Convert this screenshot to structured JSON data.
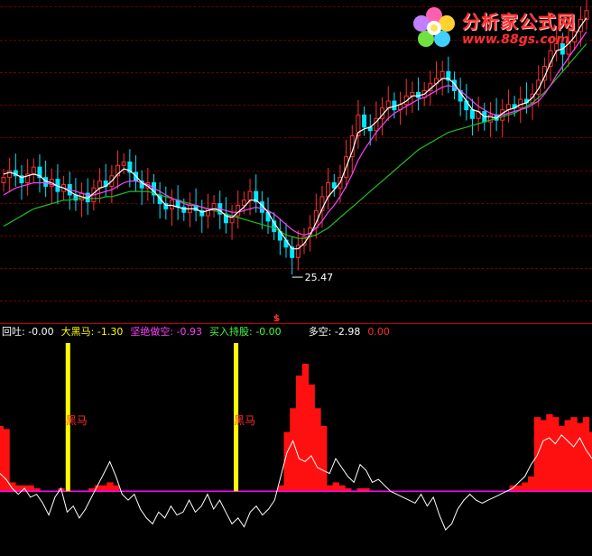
{
  "chart_data": [
    {
      "type": "candlestick",
      "ylim": [
        23.5,
        41
      ],
      "low_annotation": {
        "label": "25.47",
        "value": 25.47
      },
      "signal_marker": "$",
      "colors": {
        "up": "#ff3030",
        "down": "#00e5ff",
        "ma_white": "#ffffff",
        "ma_magenta": "#ff40ff",
        "ma_green": "#20c020"
      },
      "close": [
        31.2,
        31.6,
        31.3,
        30.9,
        31.4,
        31.8,
        31.2,
        30.7,
        31.1,
        30.4,
        30.8,
        30.2,
        29.9,
        30.3,
        29.8,
        30.6,
        31.0,
        30.7,
        31.3,
        31.9,
        32.1,
        31.5,
        31.0,
        30.6,
        30.9,
        30.2,
        29.7,
        29.4,
        29.9,
        29.5,
        29.2,
        29.6,
        29.3,
        29.0,
        29.4,
        29.7,
        29.1,
        28.6,
        29.0,
        29.6,
        29.9,
        30.4,
        29.8,
        29.2,
        28.7,
        28.1,
        27.6,
        27.2,
        26.6,
        27.3,
        27.8,
        28.3,
        29.3,
        30.1,
        30.9,
        30.6,
        31.2,
        32.4,
        33.6,
        34.8,
        34.1,
        33.9,
        34.6,
        35.2,
        35.6,
        35.1,
        35.4,
        35.9,
        36.1,
        35.8,
        36.2,
        36.6,
        36.9,
        37.3,
        36.8,
        36.2,
        35.6,
        35.1,
        34.6,
        35.0,
        34.4,
        34.8,
        34.5,
        35.1,
        35.4,
        35.2,
        35.7,
        35.5,
        36.0,
        36.8,
        37.6,
        38.5,
        38.9,
        38.3,
        39.0,
        39.6,
        40.3,
        40.8
      ],
      "ma_white": [
        31.4,
        31.5,
        31.4,
        31.2,
        31.3,
        31.4,
        31.3,
        31.0,
        30.9,
        30.7,
        30.6,
        30.4,
        30.2,
        30.1,
        30.0,
        30.3,
        30.6,
        30.7,
        31.0,
        31.4,
        31.7,
        31.6,
        31.3,
        30.9,
        30.7,
        30.4,
        30.0,
        29.6,
        29.6,
        29.5,
        29.4,
        29.4,
        29.4,
        29.2,
        29.3,
        29.4,
        29.3,
        29.0,
        28.9,
        29.2,
        29.5,
        29.9,
        29.9,
        29.6,
        29.2,
        28.6,
        28.1,
        27.6,
        27.1,
        27.1,
        27.4,
        27.9,
        28.6,
        29.4,
        30.1,
        30.5,
        30.9,
        31.8,
        32.7,
        33.8,
        34.0,
        34.1,
        34.4,
        34.8,
        35.2,
        35.3,
        35.4,
        35.6,
        35.9,
        35.9,
        36.0,
        36.3,
        36.6,
        36.9,
        36.9,
        36.6,
        36.1,
        35.6,
        35.1,
        35.0,
        34.7,
        34.7,
        34.6,
        34.9,
        35.1,
        35.2,
        35.4,
        35.5,
        35.8,
        36.3,
        37.0,
        37.8,
        38.5,
        38.6,
        38.9,
        39.3,
        39.9,
        40.4
      ],
      "ma_magenta": [
        30.2,
        30.4,
        30.6,
        30.7,
        30.8,
        30.9,
        30.9,
        30.9,
        30.8,
        30.7,
        30.6,
        30.5,
        30.4,
        30.3,
        30.2,
        30.2,
        30.3,
        30.4,
        30.5,
        30.7,
        30.9,
        31.0,
        31.0,
        30.9,
        30.8,
        30.6,
        30.4,
        30.2,
        30.0,
        29.9,
        29.7,
        29.6,
        29.6,
        29.5,
        29.4,
        29.4,
        29.4,
        29.3,
        29.2,
        29.2,
        29.3,
        29.4,
        29.5,
        29.4,
        29.3,
        29.1,
        28.8,
        28.5,
        28.2,
        28.0,
        27.9,
        28.0,
        28.3,
        28.7,
        29.2,
        29.6,
        30.1,
        30.7,
        31.4,
        32.2,
        32.8,
        33.3,
        33.8,
        34.2,
        34.6,
        34.9,
        35.1,
        35.3,
        35.5,
        35.7,
        35.8,
        36.0,
        36.2,
        36.4,
        36.5,
        36.4,
        36.2,
        35.9,
        35.6,
        35.3,
        35.1,
        34.9,
        34.8,
        34.8,
        34.9,
        35.0,
        35.1,
        35.2,
        35.4,
        35.6,
        36.0,
        36.5,
        37.1,
        37.6,
        38.1,
        38.6,
        39.1,
        39.6
      ],
      "ma_green": [
        28.4,
        28.6,
        28.8,
        29.0,
        29.2,
        29.4,
        29.5,
        29.6,
        29.7,
        29.8,
        29.9,
        29.9,
        30.0,
        30.0,
        30.0,
        30.0,
        30.0,
        30.1,
        30.1,
        30.2,
        30.3,
        30.4,
        30.4,
        30.4,
        30.4,
        30.3,
        30.2,
        30.1,
        30.0,
        29.9,
        29.8,
        29.7,
        29.6,
        29.5,
        29.4,
        29.3,
        29.2,
        29.1,
        29.0,
        28.9,
        28.8,
        28.7,
        28.6,
        28.5,
        28.4,
        28.3,
        28.1,
        27.9,
        27.8,
        27.7,
        27.7,
        27.8,
        27.9,
        28.1,
        28.3,
        28.6,
        28.9,
        29.2,
        29.5,
        29.8,
        30.1,
        30.4,
        30.7,
        31.0,
        31.3,
        31.6,
        31.9,
        32.2,
        32.5,
        32.8,
        33.0,
        33.2,
        33.4,
        33.6,
        33.8,
        33.9,
        34.0,
        34.1,
        34.2,
        34.3,
        34.4,
        34.5,
        34.6,
        34.7,
        34.8,
        34.9,
        35.1,
        35.3,
        35.5,
        35.8,
        36.1,
        36.5,
        36.9,
        37.3,
        37.7,
        38.1,
        38.5,
        38.9
      ]
    },
    {
      "type": "line",
      "legend": [
        {
          "label": "回吐: ",
          "value": "-0.00",
          "color": "#ffffff"
        },
        {
          "label": "大黑马: ",
          "value": "-1.30",
          "color": "#ffff00"
        },
        {
          "label": "坚绝做空: ",
          "value": "-0.93",
          "color": "#ff40ff"
        },
        {
          "label": "买入持股: ",
          "value": "-0.00",
          "color": "#40ff40"
        },
        {
          "label": "多空: ",
          "value": "-2.98",
          "color": "#ffffff"
        },
        {
          "label": "",
          "value": "0.00",
          "color": "#ff3030"
        }
      ],
      "signal_label": "黑马",
      "signal_positions": [
        0.114,
        0.398
      ],
      "ylim": [
        -10,
        25
      ],
      "x": [
        0,
        1,
        2,
        3,
        4,
        5,
        6,
        7,
        8,
        9,
        10,
        11,
        12,
        13,
        14,
        15,
        16,
        17,
        18,
        19,
        20,
        21,
        22,
        23,
        24,
        25,
        26,
        27,
        28,
        29,
        30,
        31,
        32,
        33,
        34,
        35,
        36,
        37,
        38,
        39,
        40,
        41,
        42,
        43,
        44,
        45,
        46,
        47,
        48,
        49,
        50,
        51,
        52,
        53,
        54,
        55,
        56,
        57,
        58,
        59,
        60,
        61,
        62,
        63,
        64,
        65,
        66,
        67,
        68,
        69,
        70,
        71,
        72,
        73,
        74,
        75,
        76,
        77,
        78,
        79,
        80,
        81,
        82,
        83,
        84,
        85,
        86,
        87,
        88,
        89,
        90,
        91,
        92,
        93,
        94,
        95,
        96,
        97
      ],
      "duokong": [
        3.0,
        2.0,
        0.5,
        -0.5,
        0.5,
        -1.0,
        -0.5,
        -2.0,
        -4.0,
        -1.0,
        0.5,
        -3.5,
        -2.5,
        -4.5,
        -3.0,
        -1.0,
        1.0,
        3.0,
        5.0,
        2.5,
        -0.5,
        -1.5,
        -0.5,
        -3.0,
        -4.5,
        -5.5,
        -3.5,
        -4.5,
        -2.5,
        -4.0,
        -3.5,
        -1.5,
        -3.5,
        -2.5,
        -0.5,
        -3.0,
        -1.5,
        -3.5,
        -5.5,
        -4.5,
        -6.0,
        -3.5,
        -2.5,
        -4.0,
        -3.0,
        -1.5,
        2.5,
        6.5,
        8.5,
        5.5,
        5.0,
        6.0,
        4.0,
        3.5,
        3.0,
        5.5,
        4.0,
        2.5,
        1.5,
        4.5,
        3.5,
        1.5,
        2.0,
        1.0,
        0.0,
        -0.5,
        -1.0,
        -1.5,
        -2.0,
        -0.5,
        -2.5,
        -1.0,
        -4.0,
        -6.5,
        -5.5,
        -3.0,
        -1.5,
        -0.5,
        -1.5,
        -2.0,
        -1.5,
        -1.0,
        -0.5,
        0.0,
        0.5,
        1.5,
        2.5,
        4.5,
        6.0,
        8.5,
        9.0,
        8.0,
        9.5,
        8.5,
        7.5,
        9.0,
        7.0,
        5.5
      ],
      "red_bars": [
        11.0,
        10.5,
        1.5,
        1.0,
        1.0,
        1.0,
        0.5,
        0.0,
        0.0,
        0.0,
        0.5,
        0.0,
        0.0,
        0.0,
        0.0,
        0.5,
        1.0,
        1.0,
        1.5,
        1.0,
        0.0,
        0.0,
        0.0,
        0.0,
        0.0,
        0.0,
        0.0,
        0.0,
        0.0,
        0.0,
        0.0,
        0.0,
        0.0,
        0.0,
        0.0,
        0.0,
        0.0,
        0.0,
        0.0,
        0.0,
        0.0,
        0.0,
        0.0,
        0.0,
        0.0,
        0.0,
        1.0,
        10.0,
        14.0,
        19.5,
        21.5,
        18.0,
        14.0,
        11.0,
        1.0,
        1.5,
        1.0,
        0.5,
        0.0,
        0.5,
        0.5,
        0.0,
        0.0,
        0.0,
        0.0,
        0.0,
        0.0,
        0.0,
        0.0,
        0.0,
        0.0,
        0.0,
        0.0,
        0.0,
        0.0,
        0.0,
        0.0,
        0.0,
        0.0,
        0.0,
        0.0,
        0.0,
        0.0,
        0.0,
        1.0,
        1.0,
        1.5,
        2.5,
        12.5,
        12.0,
        13.0,
        12.5,
        11.0,
        12.0,
        12.5,
        11.5,
        12.5,
        10.0
      ],
      "zero_line_color": "#ff00ff"
    }
  ],
  "logo": {
    "title": "分析家公式网",
    "url": "www.88gs.com",
    "flower_icon": "flower-logo-icon"
  }
}
